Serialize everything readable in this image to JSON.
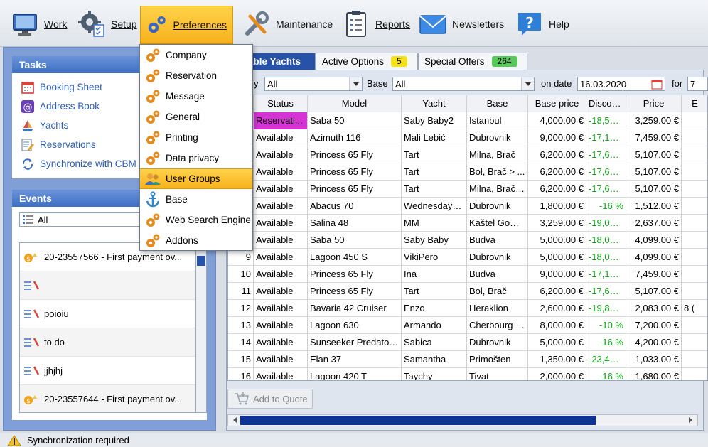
{
  "toolbar": {
    "items": [
      {
        "label": "Work",
        "icon": "monitor-icon"
      },
      {
        "label": "Setup",
        "icon": "gear-checklist-icon"
      },
      {
        "label": "Preferences",
        "icon": "gears-icon"
      },
      {
        "label": "Maintenance",
        "icon": "wrench-screwdriver-icon"
      },
      {
        "label": "Reports",
        "icon": "clipboard-icon"
      },
      {
        "label": "Newsletters",
        "icon": "envelope-icon"
      },
      {
        "label": "Help",
        "icon": "question-bubble-icon"
      }
    ]
  },
  "preferences_menu": {
    "items": [
      {
        "label": "Company"
      },
      {
        "label": "Reservation"
      },
      {
        "label": "Message"
      },
      {
        "label": "General"
      },
      {
        "label": "Printing"
      },
      {
        "label": "Data privacy"
      },
      {
        "label": "User Groups",
        "highlighted": true
      },
      {
        "label": "Base"
      },
      {
        "label": "Web Search Engine"
      },
      {
        "label": "Addons"
      }
    ]
  },
  "tasks": {
    "title": "Tasks",
    "items": [
      {
        "label": "Booking Sheet",
        "icon": "calendar-icon"
      },
      {
        "label": "Address Book",
        "icon": "at-sign-icon"
      },
      {
        "label": "Yachts",
        "icon": "sailboat-icon"
      },
      {
        "label": "Reservations",
        "icon": "document-pen-icon"
      },
      {
        "label": "Synchronize with CBM",
        "icon": "sync-icon"
      }
    ]
  },
  "events": {
    "title": "Events",
    "filter_value": "All",
    "rows": [
      {
        "text": "20-23557566 - First payment ov..."
      },
      {
        "text": ""
      },
      {
        "text": "poioiu"
      },
      {
        "text": "to do"
      },
      {
        "text": "jjhjhj"
      },
      {
        "text": "20-23557644 - First payment ov..."
      }
    ]
  },
  "tabs": [
    {
      "label": "able Yachts",
      "active": true
    },
    {
      "label": "Active Options",
      "count": "5",
      "badge_color": "#f5e11a"
    },
    {
      "label": "Special Offers",
      "count": "264",
      "badge_color": "#58c85a"
    }
  ],
  "filters": {
    "first_label": "y",
    "first_value": "All",
    "base_label": "Base",
    "base_value": "All",
    "date_label": "on date",
    "date_value": "16.03.2020",
    "for_label": "for",
    "for_value": "7"
  },
  "grid": {
    "columns": [
      "",
      "Status",
      "Model",
      "Yacht",
      "Base",
      "Base price",
      "Discount",
      "Price",
      "E"
    ],
    "rows": [
      {
        "num": "",
        "status": "Reservati...",
        "model": "Saba 50",
        "yacht": "Saby Baby2",
        "base": "Istanbul",
        "base_price": "4,000.00 €",
        "discount": "-18,52 ...",
        "price": "3,259.00 €",
        "extra": ""
      },
      {
        "num": "",
        "status": "Available",
        "model": "Azimuth 116",
        "yacht": "Mali Lebić",
        "base": "Dubrovnik",
        "base_price": "9,000.00 €",
        "discount": "-17,12 ...",
        "price": "7,459.00 €",
        "extra": ""
      },
      {
        "num": "",
        "status": "Available",
        "model": "Princess 65 Fly",
        "yacht": "Tart",
        "base": "Milna, Brač",
        "base_price": "6,200.00 €",
        "discount": "-17,63 ...",
        "price": "5,107.00 €",
        "extra": ""
      },
      {
        "num": "",
        "status": "Available",
        "model": "Princess 65 Fly",
        "yacht": "Tart",
        "base": "Bol, Brač > ...",
        "base_price": "6,200.00 €",
        "discount": "-17,63 ...",
        "price": "5,107.00 €",
        "extra": ""
      },
      {
        "num": "",
        "status": "Available",
        "model": "Princess 65 Fly",
        "yacht": "Tart",
        "base": "Milna, Brač ...",
        "base_price": "6,200.00 €",
        "discount": "-17,63 ...",
        "price": "5,107.00 €",
        "extra": ""
      },
      {
        "num": "",
        "status": "Available",
        "model": "Abacus 70",
        "yacht": "Wednesday t...",
        "base": "Dubrovnik",
        "base_price": "1,800.00 €",
        "discount": "-16 %",
        "price": "1,512.00 €",
        "extra": ""
      },
      {
        "num": "",
        "status": "Available",
        "model": "Salina 48",
        "yacht": "MM",
        "base": "Kaštel Gomi...",
        "base_price": "3,259.00 €",
        "discount": "-19,09 ...",
        "price": "2,637.00 €",
        "extra": ""
      },
      {
        "num": "",
        "status": "Available",
        "model": "Saba 50",
        "yacht": "Saby Baby",
        "base": "Budva",
        "base_price": "5,000.00 €",
        "discount": "-18,02 ...",
        "price": "4,099.00 €",
        "extra": ""
      },
      {
        "num": "9",
        "status": "Available",
        "model": "Lagoon 450 S",
        "yacht": "VikiPero",
        "base": "Dubrovnik",
        "base_price": "5,000.00 €",
        "discount": "-18,02 ...",
        "price": "4,099.00 €",
        "extra": ""
      },
      {
        "num": "10",
        "status": "Available",
        "model": "Princess 65 Fly",
        "yacht": "Ina",
        "base": "Budva",
        "base_price": "9,000.00 €",
        "discount": "-17,12 ...",
        "price": "7,459.00 €",
        "extra": ""
      },
      {
        "num": "11",
        "status": "Available",
        "model": "Princess 65 Fly",
        "yacht": "Tart",
        "base": "Bol, Brač",
        "base_price": "6,200.00 €",
        "discount": "-17,63 ...",
        "price": "5,107.00 €",
        "extra": ""
      },
      {
        "num": "12",
        "status": "Available",
        "model": "Bavaria 42 Cruiser",
        "yacht": "Enzo",
        "base": "Heraklion",
        "base_price": "2,600.00 €",
        "discount": "-19,88 ...",
        "price": "2,083.00 €",
        "extra": "8 ("
      },
      {
        "num": "13",
        "status": "Available",
        "model": "Lagoon 630",
        "yacht": "Armando",
        "base": "Cherbourg - ...",
        "base_price": "8,000.00 €",
        "discount": "-10 %",
        "price": "7,200.00 €",
        "extra": ""
      },
      {
        "num": "14",
        "status": "Available",
        "model": "Sunseeker Predator ...",
        "yacht": "Sabica",
        "base": "Dubrovnik",
        "base_price": "5,000.00 €",
        "discount": "-16 %",
        "price": "4,200.00 €",
        "extra": ""
      },
      {
        "num": "15",
        "status": "Available",
        "model": "Elan 37",
        "yacht": "Samantha",
        "base": "Primošten",
        "base_price": "1,350.00 €",
        "discount": "-23,47 ...",
        "price": "1,033.00 €",
        "extra": ""
      },
      {
        "num": "16",
        "status": "Available",
        "model": "Lagoon 420 T",
        "yacht": "Taychy",
        "base": "Tivat",
        "base_price": "2,000.00 €",
        "discount": "-16 %",
        "price": "1,680.00 €",
        "extra": ""
      }
    ]
  },
  "add_to_quote_label": "Add to Quote",
  "status_bar": {
    "text": "Synchronization required",
    "icon": "warning-icon"
  },
  "colors": {
    "accent": "#2752a8",
    "highlight": "#f7b21c",
    "reservation": "#d633d6",
    "discount_text": "#12a51c"
  }
}
